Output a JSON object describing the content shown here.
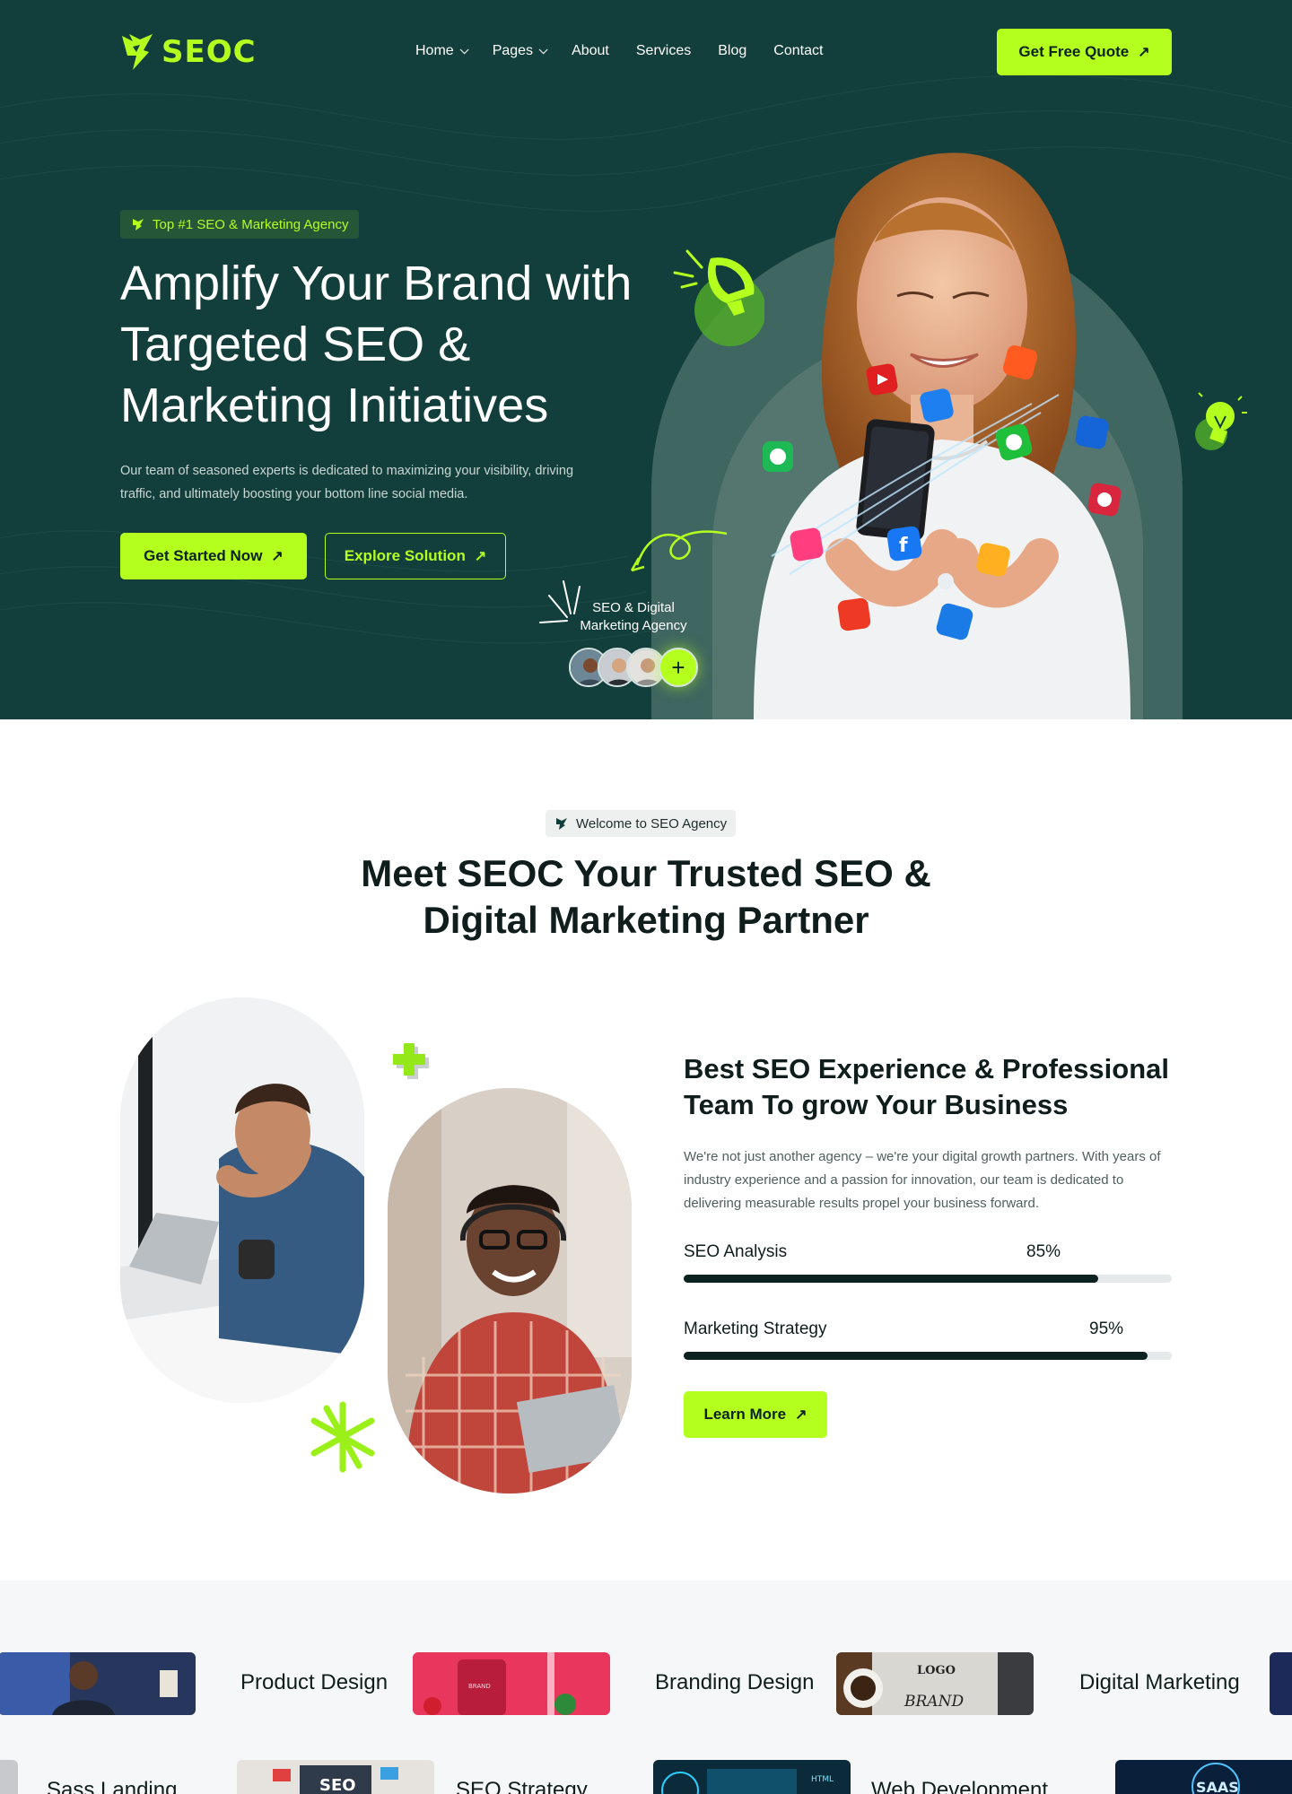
{
  "nav": {
    "logo_text": "SEOC",
    "menu": [
      {
        "label": "Home",
        "has_dropdown": true
      },
      {
        "label": "Pages",
        "has_dropdown": true
      },
      {
        "label": "About",
        "has_dropdown": false
      },
      {
        "label": "Services",
        "has_dropdown": false
      },
      {
        "label": "Blog",
        "has_dropdown": false
      },
      {
        "label": "Contact",
        "has_dropdown": false
      }
    ],
    "quote_button": "Get Free Quote"
  },
  "hero": {
    "badge": "Top #1 SEO & Marketing Agency",
    "title": "Amplify Your Brand with Targeted SEO & Marketing Initiatives",
    "description": "Our team of seasoned experts is dedicated to maximizing your visibility, driving traffic, and ultimately boosting your bottom line social media.",
    "primary_button": "Get Started Now",
    "secondary_button": "Explore Solution",
    "tag_line1": "SEO & Digital",
    "tag_line2": "Marketing Agency",
    "plus_symbol": "+"
  },
  "about": {
    "badge": "Welcome to SEO Agency",
    "title_line1": "Meet SEOC Your Trusted SEO &",
    "title_line2": "Digital Marketing Partner",
    "experience_title": "Best SEO Experience & Professional Team To grow Your Business",
    "experience_description": "We're not just another agency – we're your digital growth partners. With years of industry experience and a passion for innovation, our team is dedicated to delivering measurable results  propel your business forward.",
    "skills": [
      {
        "label": "SEO Analysis",
        "percent_text": "85%",
        "value": 0.85
      },
      {
        "label": "Marketing Strategy",
        "percent_text": "95%",
        "value": 0.95
      }
    ],
    "learn_button": "Learn More"
  },
  "services_strip": {
    "row1": [
      "Product Design",
      "Branding Design",
      "Digital Marketing"
    ],
    "row2": [
      "Sass Landing",
      "SEO Strategy",
      "Web Development"
    ],
    "thumb_texts": {
      "logo_top": "LOGO",
      "logo_bottom": "BRAND",
      "seo": "SEO",
      "html": "HTML",
      "saas": "SAAS",
      "brand_jar": "BRAND"
    }
  },
  "colors": {
    "hero_bg": "#123f3b",
    "accent": "#b5ff1f",
    "dark_text": "#0f1d1c",
    "progress_fill": "#0b2220"
  },
  "icons": [
    "logo-icon",
    "chevron-down-icon",
    "arrow-up-right-icon",
    "flag-icon",
    "megaphone-icon",
    "lightbulb-icon",
    "plus-icon",
    "asterisk-icon"
  ]
}
